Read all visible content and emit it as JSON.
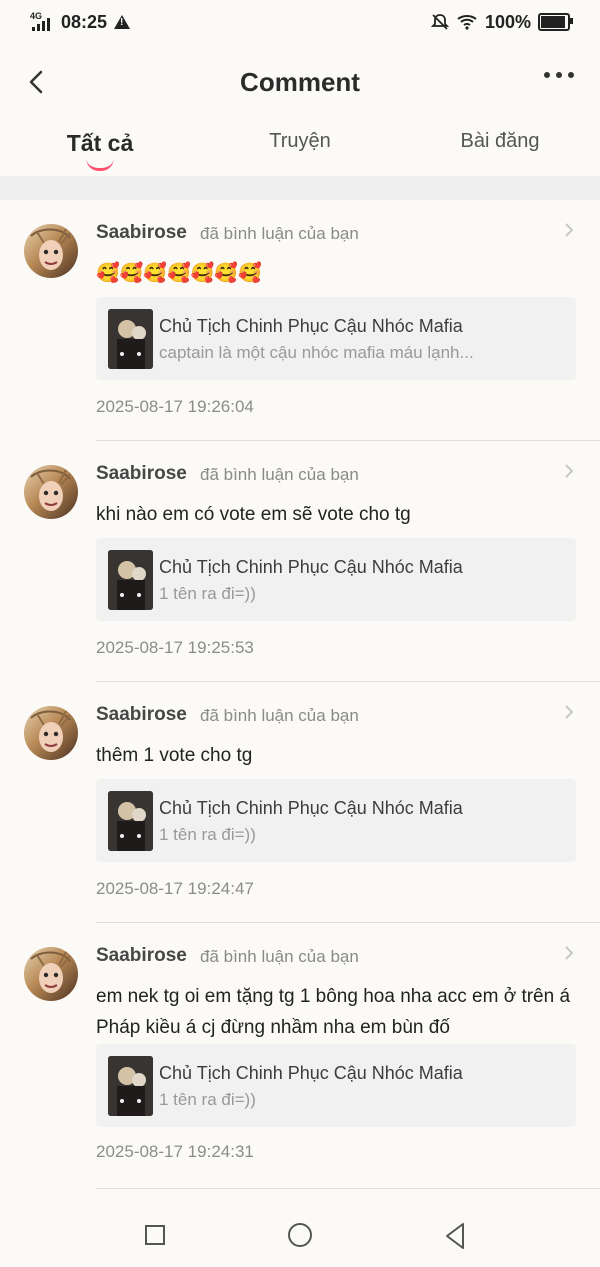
{
  "status_bar": {
    "network": "4G",
    "time": "08:25",
    "battery": "100%"
  },
  "header": {
    "title": "Comment"
  },
  "tabs": [
    {
      "label": "Tất cả",
      "active": true
    },
    {
      "label": "Truyện",
      "active": false
    },
    {
      "label": "Bài đăng",
      "active": false
    }
  ],
  "comments": [
    {
      "user": "Saabirose",
      "action": "đã bình luận của bạn",
      "content": "🥰🥰🥰🥰🥰🥰🥰",
      "card_title": "Chủ Tịch Chinh Phục Cậu Nhóc Mafia",
      "card_desc": "captain là một cậu nhóc mafia máu lạnh...",
      "time": "2025-08-17 19:26:04"
    },
    {
      "user": "Saabirose",
      "action": "đã bình luận của bạn",
      "content": "khi nào em có vote em sẽ vote cho tg",
      "card_title": "Chủ Tịch Chinh Phục Cậu Nhóc Mafia",
      "card_desc": "1 tên ra đi=))",
      "time": "2025-08-17 19:25:53"
    },
    {
      "user": "Saabirose",
      "action": "đã bình luận của bạn",
      "content": "thêm 1 vote cho tg",
      "card_title": "Chủ Tịch Chinh Phục Cậu Nhóc Mafia",
      "card_desc": "1 tên ra đi=))",
      "time": "2025-08-17 19:24:47"
    },
    {
      "user": "Saabirose",
      "action": "đã bình luận của bạn",
      "content": "em nek tg oi em tặng tg 1 bông hoa nha acc em ở trên á Pháp kiều á cj đừng nhầm nha em bùn đố",
      "card_title": "Chủ Tịch Chinh Phục Cậu Nhóc Mafia",
      "card_desc": "1 tên ra đi=))",
      "time": "2025-08-17 19:24:31"
    }
  ]
}
